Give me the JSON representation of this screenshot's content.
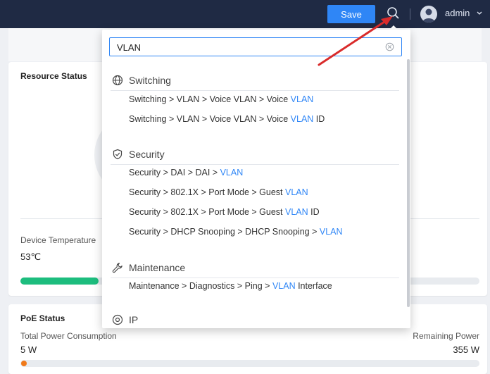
{
  "header": {
    "save_label": "Save",
    "user_name": "admin"
  },
  "search": {
    "value": "VLAN",
    "groups": [
      {
        "label": "Switching",
        "icon": "globe-icon",
        "items": [
          {
            "prefix": "Switching > VLAN > Voice VLAN > Voice ",
            "match": "VLAN",
            "suffix": ""
          },
          {
            "prefix": "Switching > VLAN > Voice VLAN > Voice ",
            "match": "VLAN",
            "suffix": " ID"
          }
        ]
      },
      {
        "label": "Security",
        "icon": "shield-icon",
        "items": [
          {
            "prefix": "Security > DAI > DAI > ",
            "match": "VLAN",
            "suffix": ""
          },
          {
            "prefix": "Security > 802.1X > Port Mode > Guest ",
            "match": "VLAN",
            "suffix": ""
          },
          {
            "prefix": "Security > 802.1X > Port Mode > Guest ",
            "match": "VLAN",
            "suffix": " ID"
          },
          {
            "prefix": "Security > DHCP Snooping > DHCP Snooping > ",
            "match": "VLAN",
            "suffix": ""
          }
        ]
      },
      {
        "label": "Maintenance",
        "icon": "wrench-icon",
        "items": [
          {
            "prefix": "Maintenance > Diagnostics > Ping > ",
            "match": "VLAN",
            "suffix": " Interface"
          }
        ]
      },
      {
        "label": "IP",
        "icon": "ip-icon",
        "items": []
      }
    ]
  },
  "resource": {
    "title": "Resource Status",
    "temp_label": "Device Temperature",
    "temp_value": "53℃",
    "temp_level": 0.17
  },
  "poe": {
    "title": "PoE Status",
    "total_label": "Total Power Consumption",
    "total_value": "5 W",
    "remaining_label": "Remaining Power",
    "remaining_value": "355 W"
  },
  "colors": {
    "accent": "#2f86f6",
    "topbar": "#1f2a44",
    "temp_bar": "#1dbd7e",
    "poe_dot": "#f07a1a",
    "arrow": "#d92b2b"
  }
}
